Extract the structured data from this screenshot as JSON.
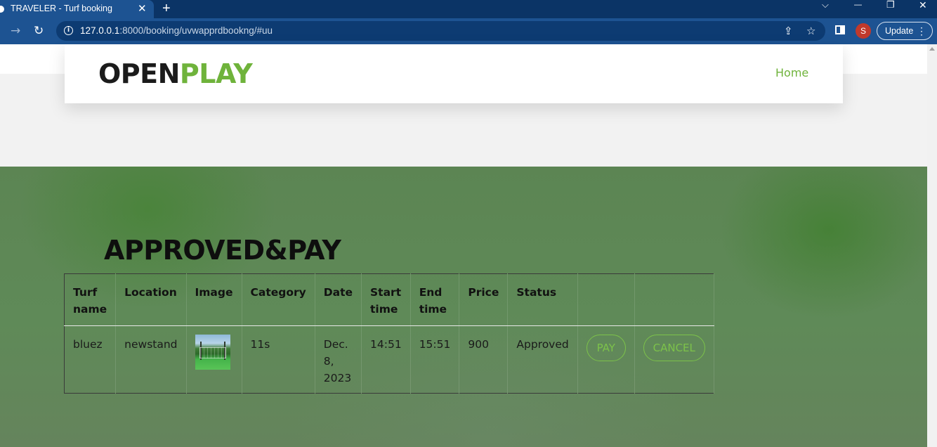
{
  "browser": {
    "tab_title": "TRAVELER - Turf booking",
    "tab_close": "✕",
    "new_tab": "+",
    "url_host": "127.0.0.1",
    "url_path": ":8000/booking/uvwapprdbookng/#uu",
    "profile_initial": "S",
    "update_label": "Update",
    "update_menu": "⋮",
    "window_controls": {
      "dropdown": "⌵",
      "minimize": "—",
      "restore": "❐",
      "close": "✕"
    },
    "nav": {
      "back": "→",
      "reload": "↻"
    },
    "omnibox_icons": {
      "info": "i",
      "share": "⇪",
      "bookmark": "☆"
    }
  },
  "header": {
    "logo_part1": "OPEN",
    "logo_part2": "PLAY",
    "nav_home": "Home"
  },
  "section": {
    "title": "APPROVED&PAY"
  },
  "table": {
    "headers": [
      "Turf name",
      "Location",
      "Image",
      "Category",
      "Date",
      "Start time",
      "End time",
      "Price",
      "Status",
      ""
    ],
    "rows": [
      {
        "turf_name": "bluez",
        "location": "newstand",
        "image_icon": "turf-photo",
        "category": "11s",
        "date": "Dec. 8, 2023",
        "start_time": "14:51",
        "end_time": "15:51",
        "price": "900",
        "status": "Approved",
        "pay_label": "PAY",
        "cancel_label": "CANCEL"
      }
    ]
  },
  "colors": {
    "brand_green": "#6fb33b",
    "button_green": "#7cc24a",
    "chrome_blue": "#1d5392"
  }
}
